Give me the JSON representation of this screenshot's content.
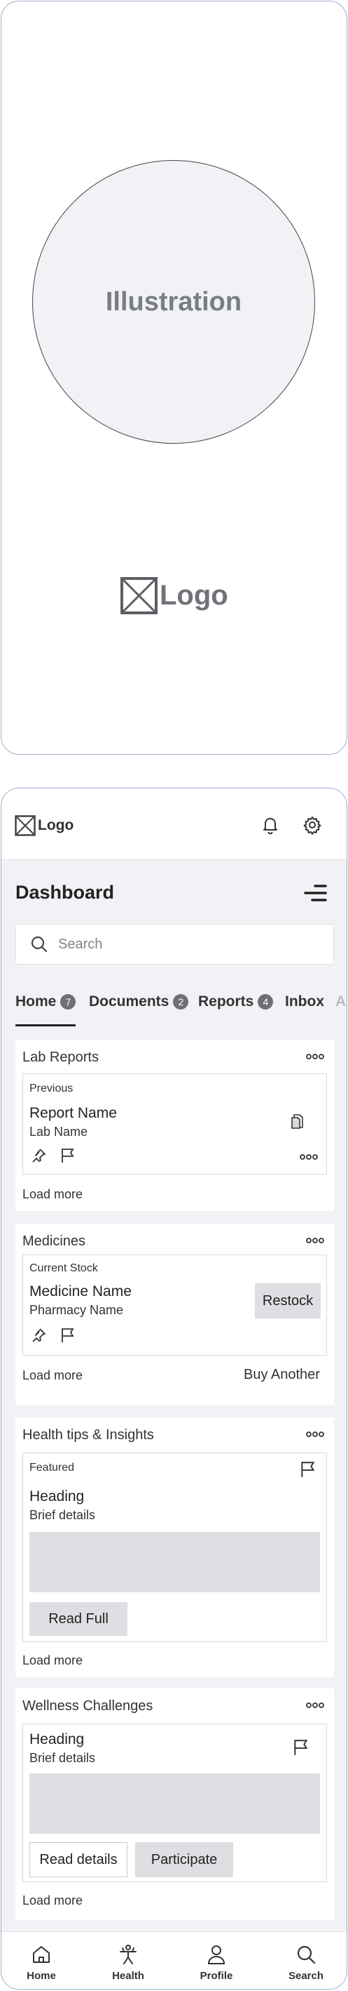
{
  "splash": {
    "illustration_label": "Illustration",
    "logo_text": "Logo"
  },
  "topbar": {
    "logo_text": "Logo",
    "icons": [
      "bell-icon",
      "gear-icon"
    ]
  },
  "dashboard": {
    "title": "Dashboard",
    "search_placeholder": "Search"
  },
  "tabs": [
    {
      "label": "Home",
      "count": "7",
      "active": true
    },
    {
      "label": "Documents",
      "count": "2"
    },
    {
      "label": "Reports",
      "count": "4"
    },
    {
      "label": "Inbox"
    },
    {
      "label": "Ac"
    }
  ],
  "lab_reports": {
    "title": "Lab Reports",
    "tag": "Previous",
    "name": "Report Name",
    "subtitle": "Lab Name",
    "load_more": "Load more"
  },
  "medicines": {
    "title": "Medicines",
    "tag": "Current Stock",
    "name": "Medicine Name",
    "subtitle": "Pharmacy Name",
    "restock": "Restock",
    "load_more": "Load more",
    "buy_another": "Buy Another"
  },
  "tips": {
    "title": "Health tips & Insights",
    "tag": "Featured",
    "heading": "Heading",
    "details": "Brief details",
    "read_full": "Read Full",
    "load_more": "Load more"
  },
  "wellness": {
    "title": "Wellness Challenges",
    "heading": "Heading",
    "details": "Brief details",
    "read_details": "Read details",
    "participate": "Participate",
    "load_more": "Load more"
  },
  "bottom_nav": [
    {
      "label": "Home",
      "icon": "home-icon"
    },
    {
      "label": "Health",
      "icon": "health-figure-icon"
    },
    {
      "label": "Profile",
      "icon": "user-icon"
    },
    {
      "label": "Search",
      "icon": "search-icon"
    }
  ]
}
